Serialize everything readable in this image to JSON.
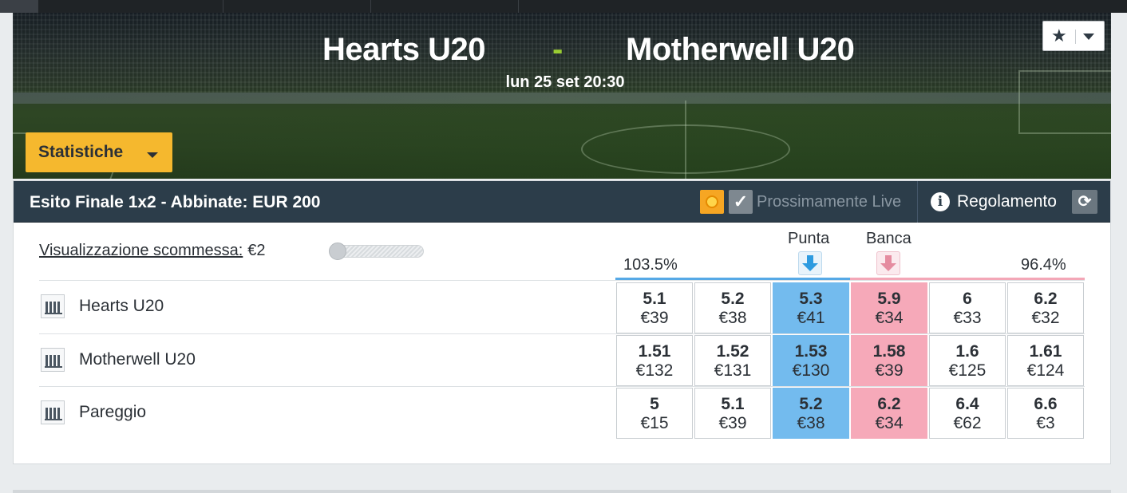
{
  "match": {
    "home_team": "Hearts U20",
    "separator": "-",
    "away_team": "Motherwell U20",
    "datetime": "lun 25 set 20:30"
  },
  "header_controls": {
    "favorite_icon": "star-icon",
    "favorite_caret_icon": "chevron-down-icon",
    "stats_label": "Statistiche"
  },
  "market": {
    "title": "Esito Finale 1x2 - Abbinate: EUR 200",
    "live_label": "Prossimamente Live",
    "rules_label": "Regolamento",
    "bet_view_label": "Visualizzazione scommessa:",
    "bet_view_amount": "€2",
    "slider_level": 0,
    "back_header": "Punta",
    "lay_header": "Banca",
    "back_book": "103.5%",
    "lay_book": "96.4%",
    "runners": [
      {
        "name": "Hearts U20",
        "prices": [
          {
            "price": "5.1",
            "size": "€39"
          },
          {
            "price": "5.2",
            "size": "€38"
          },
          {
            "price": "5.3",
            "size": "€41"
          },
          {
            "price": "5.9",
            "size": "€34"
          },
          {
            "price": "6",
            "size": "€33"
          },
          {
            "price": "6.2",
            "size": "€32"
          }
        ]
      },
      {
        "name": "Motherwell U20",
        "prices": [
          {
            "price": "1.51",
            "size": "€132"
          },
          {
            "price": "1.52",
            "size": "€131"
          },
          {
            "price": "1.53",
            "size": "€130"
          },
          {
            "price": "1.58",
            "size": "€39"
          },
          {
            "price": "1.6",
            "size": "€125"
          },
          {
            "price": "1.61",
            "size": "€124"
          }
        ]
      },
      {
        "name": "Pareggio",
        "prices": [
          {
            "price": "5",
            "size": "€15"
          },
          {
            "price": "5.1",
            "size": "€39"
          },
          {
            "price": "5.2",
            "size": "€38"
          },
          {
            "price": "6.2",
            "size": "€34"
          },
          {
            "price": "6.4",
            "size": "€62"
          },
          {
            "price": "6.6",
            "size": "€3"
          }
        ]
      }
    ]
  },
  "colors": {
    "accent_yellow": "#f5b82e",
    "header_bg": "#2c3d4a",
    "back_best": "#73bbee",
    "lay_best": "#f6a9b9",
    "dash": "#9acd32"
  }
}
